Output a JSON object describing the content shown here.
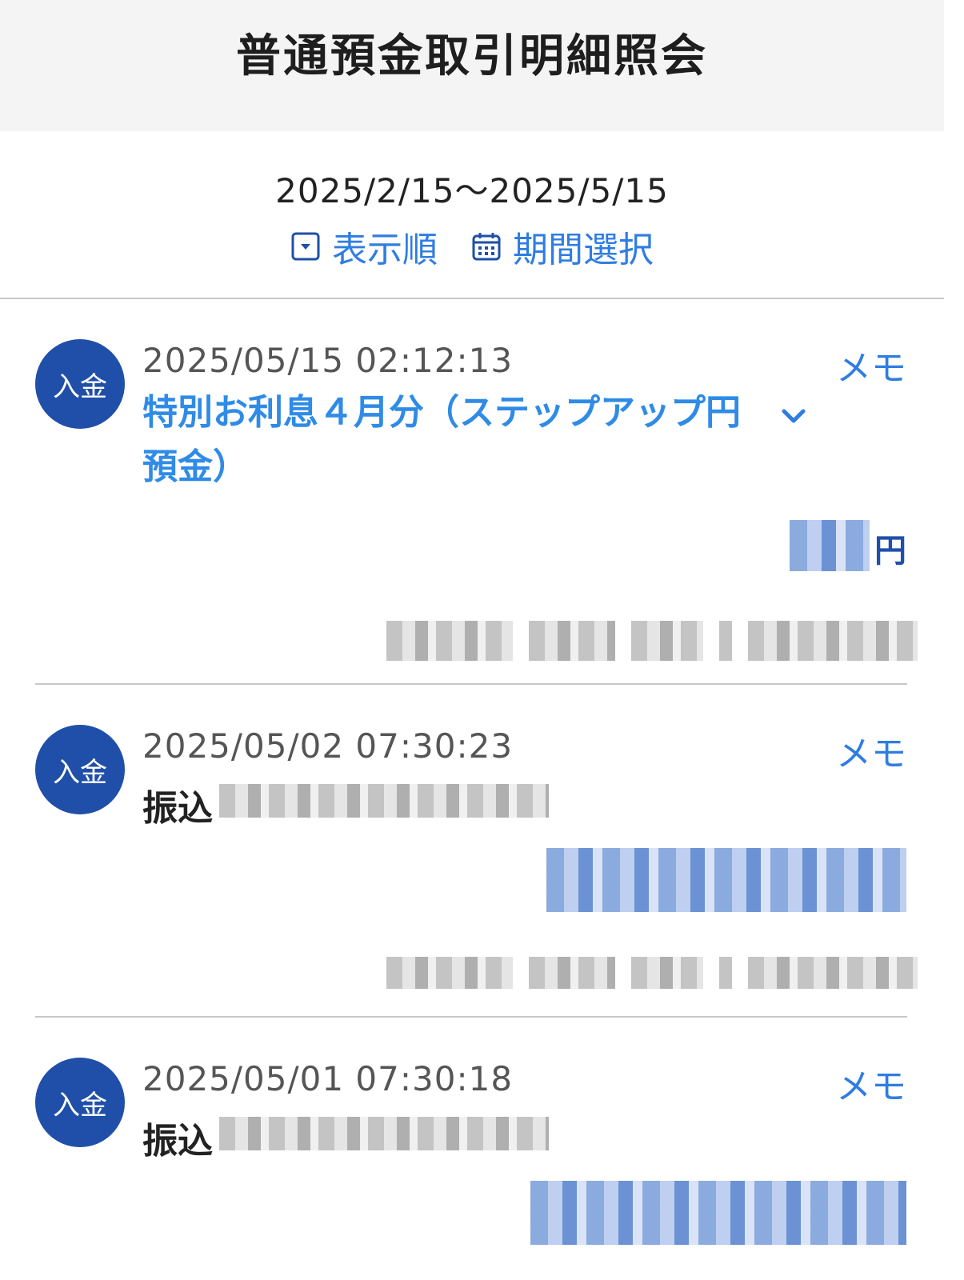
{
  "header": {
    "title": "普通預金取引明細照会"
  },
  "period": {
    "range": "2025/2/15〜2025/5/15"
  },
  "controls": {
    "sort_label": "表示順",
    "period_label": "期間選択"
  },
  "colors": {
    "accent": "#2f7de1",
    "badge": "#1f4fa8",
    "header_bg": "#f4f4f4"
  },
  "transactions": [
    {
      "type": "入金",
      "datetime": "2025/05/15 02:12:13",
      "memo": "メモ",
      "description": "特別お利息４月分（ステップアップ円預金）",
      "description_style": "link",
      "amount_unit": "円"
    },
    {
      "type": "入金",
      "datetime": "2025/05/02 07:30:23",
      "memo": "メモ",
      "description": "振込",
      "description_style": "plain"
    },
    {
      "type": "入金",
      "datetime": "2025/05/01 07:30:18",
      "memo": "メモ",
      "description": "振込",
      "description_style": "plain"
    }
  ]
}
